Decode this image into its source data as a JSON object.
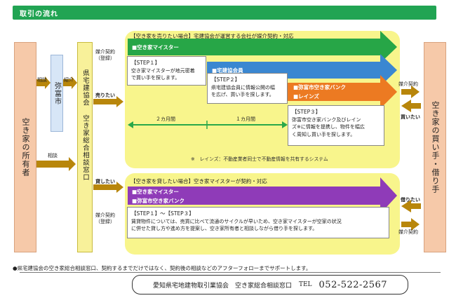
{
  "header": {
    "title": "取引の流れ",
    "color": "#21a453"
  },
  "owner_box": {
    "label": "空き家の所有者"
  },
  "buyer_box": {
    "label": "空き家の買い手・借り手"
  },
  "city_box": {
    "label": "弥富市"
  },
  "center_box": {
    "label": "県宅建協会 空き家総合相談窓口"
  },
  "left_arrows": {
    "consult_top": "相談",
    "intro": "紹介",
    "consult_mid": "相談",
    "mediation_top": [
      "媒介契約",
      "（登録）"
    ],
    "sell_label": "売りたい",
    "rent_label": "貸したい",
    "mediation_bottom": [
      "媒介契約",
      "（登録）"
    ]
  },
  "right_arrows": {
    "mediation_top": "媒介契約",
    "buy_label": "買いたい",
    "borrow_label": "借りたい",
    "mediation_bottom": "媒介契約"
  },
  "sell": {
    "title": "【空き家を売りたい場合】宅建協会が運営する会社が媒介契約・対応",
    "bar1": "■空き家マイスター",
    "bar2": "■宅建協会員",
    "bar3a": "■弥富市空き家バンク",
    "bar3b": "■レインズ",
    "step1_title": "【STEP１】",
    "step1_lines": [
      "空き家マイスターが地元密着",
      "で買い手を探します。"
    ],
    "step2_title": "【STEP２】",
    "step2_lines": [
      "県宅建協会員に情報公開の幅",
      "を広げ、買い手を探します。"
    ],
    "step3_title": "【STEP３】",
    "step3_lines": [
      "弥富市空き家バンク及びレイン",
      "ズ※に情報を提携し、物件を幅広",
      "く周知し買い手を探します。"
    ],
    "period1": "２カ月間",
    "period2": "１カ月間",
    "note": "※　レインズ：不動産業者同士で不動産情報を共有するシステム"
  },
  "rent": {
    "title": "【空き家を貸したい場合】空き家マイスターが契約・対応",
    "bar1": "■空き家マイスター",
    "bar2": "■弥富市空き家バンク",
    "step_title": "【STEP１】～【STEP３】",
    "step_lines": [
      "賃貸物件については、売買に比べて流通のサイクルが早いため、空き家マイスターが空家の状況",
      "に併せた貸し方や進め方を提案し、空き家所有者と相談しながら借り手を探します。"
    ]
  },
  "bottom": {
    "note": "●県宅建協会の空き家総合相談窓口、契約するまでだけではなく、契約後の相談などのアフターフォローまでサポートします。",
    "org": "愛知県宅地建物取引業協会　空き家総合相談窓口",
    "tel_label": "TEL",
    "tel": "052-522-2567"
  },
  "colors": {
    "green_bar": "#27a647",
    "blue_bar": "#3a87d1",
    "orange_bar": "#ec7a22",
    "purple_bar": "#8f3bb8",
    "arrow_brown": "#b8860b",
    "yellow_region": "#f8f58c"
  }
}
